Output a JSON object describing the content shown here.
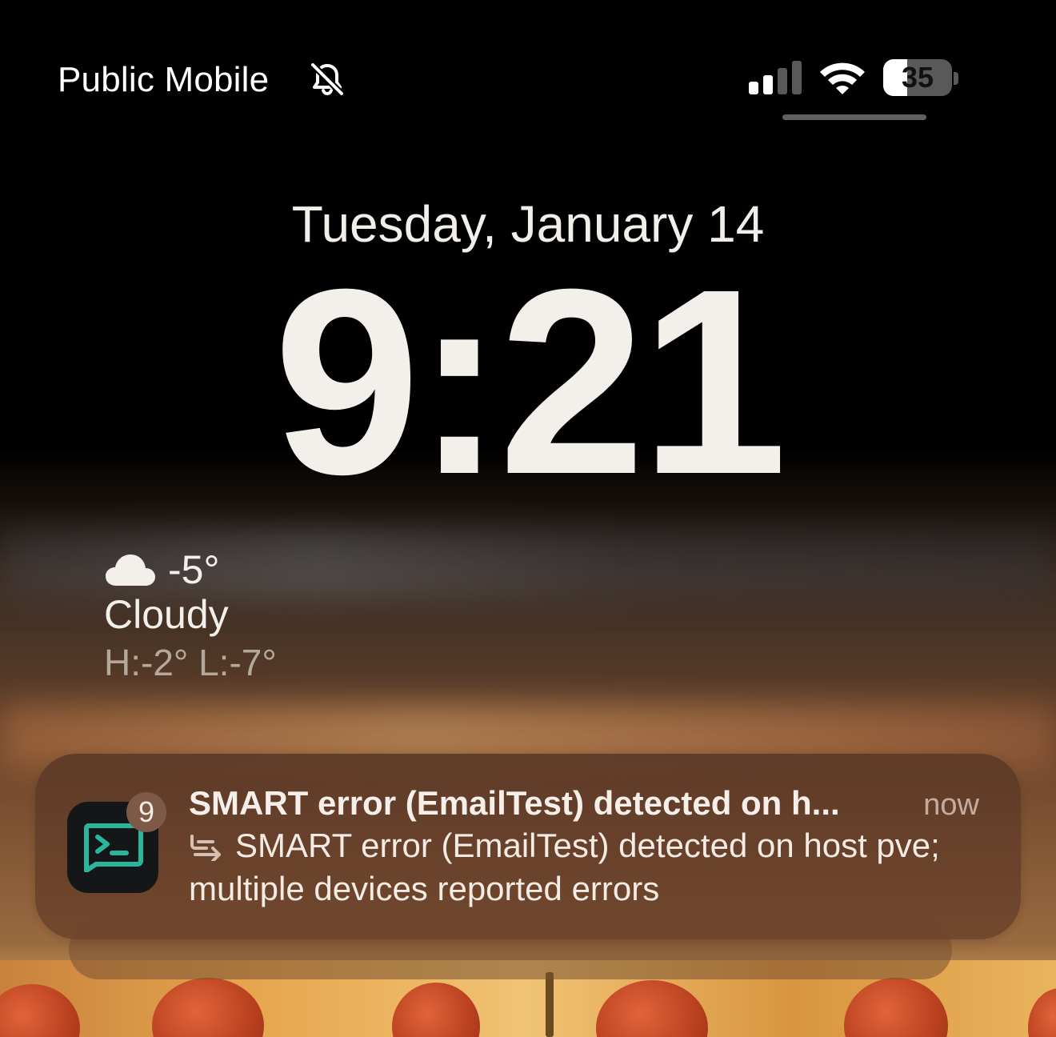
{
  "status_bar": {
    "carrier": "Public Mobile",
    "silent_icon": "bell-slash-icon",
    "signal_icon": "cellular-signal-icon",
    "signal_bars_active": 2,
    "signal_bars_total": 4,
    "wifi_icon": "wifi-icon",
    "battery_percent": "35",
    "battery_level": 0.35
  },
  "lock_screen": {
    "date": "Tuesday, January 14",
    "time": "9:21"
  },
  "weather": {
    "icon": "cloud-icon",
    "temperature": "-5°",
    "condition": "Cloudy",
    "high_low": "H:-2° L:-7°"
  },
  "notification": {
    "app_icon": "terminal-icon",
    "badge_count": "9",
    "title": "SMART error (EmailTest) detected on h...",
    "time": "now",
    "thread_icon": "thread-reply-icon",
    "body": "SMART error (EmailTest) detected on host pve; multiple devices reported errors"
  },
  "colors": {
    "terminal_accent": "#2bb59a",
    "notification_bg": "#5c3a28"
  }
}
